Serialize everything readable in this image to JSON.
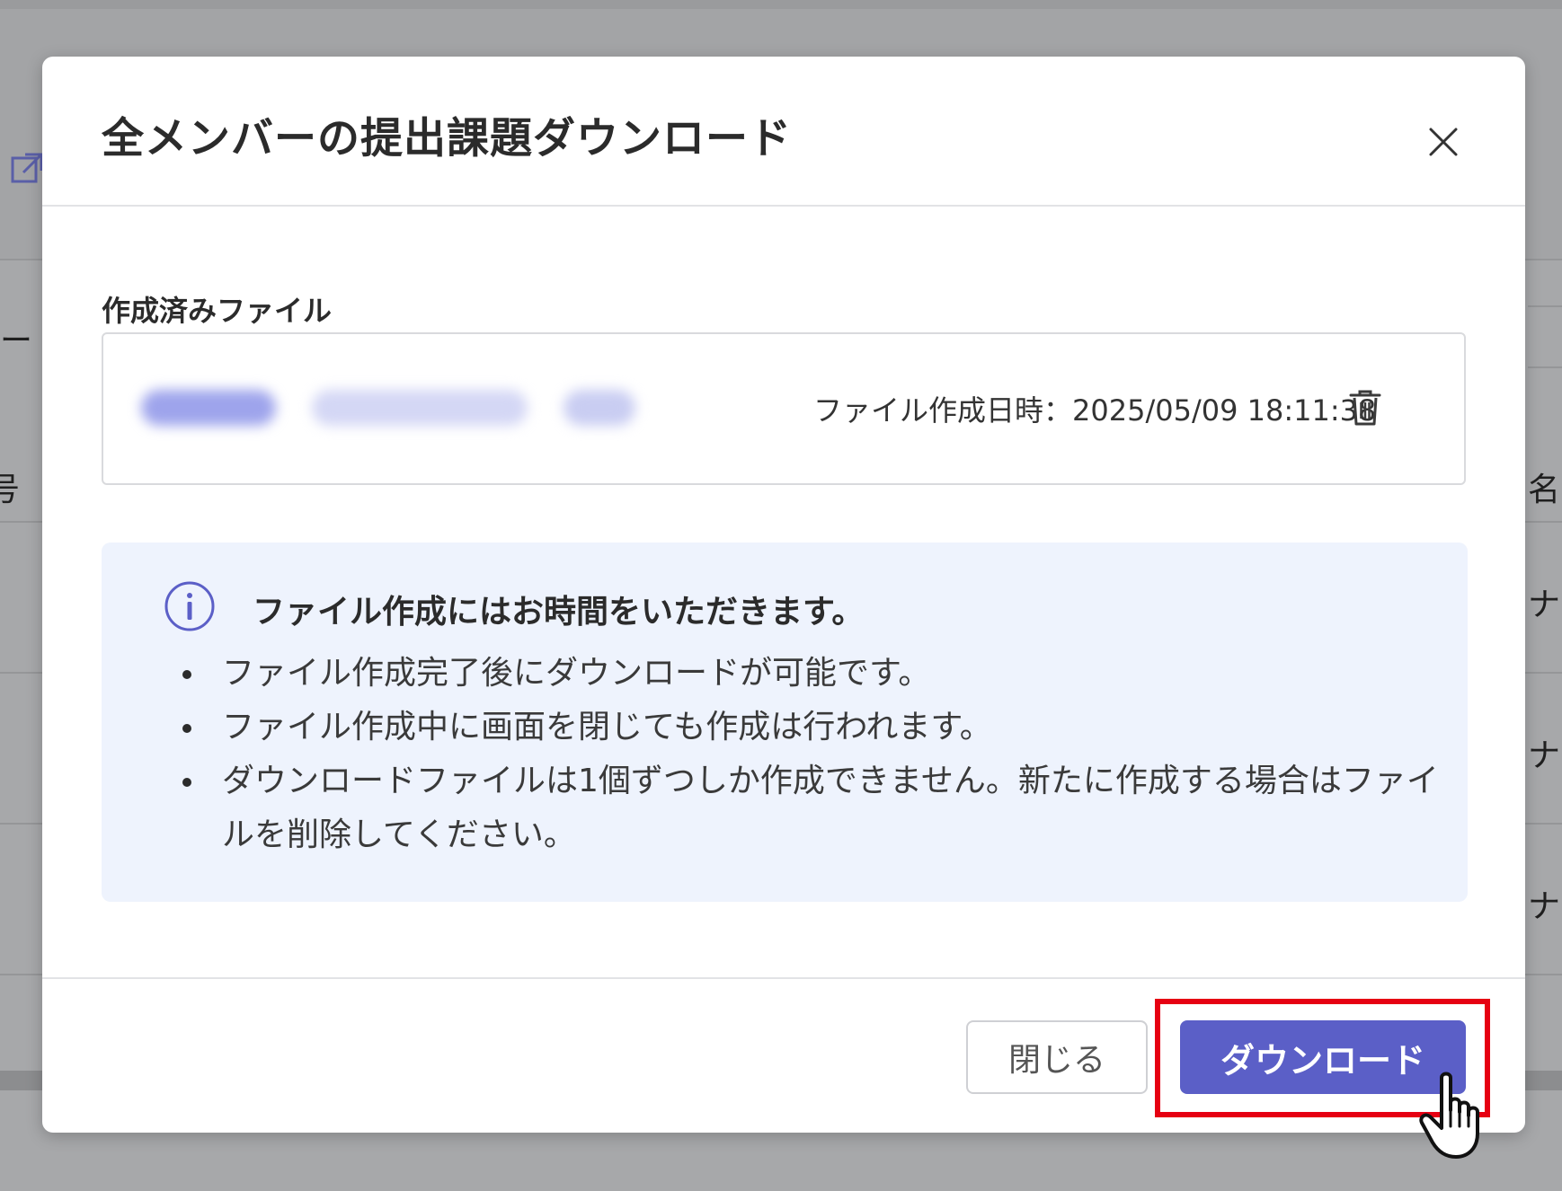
{
  "background": {
    "partial_glyphs": [
      "ー",
      "号",
      "名",
      "ナ",
      "ナ",
      "ナ"
    ]
  },
  "modal": {
    "title": "全メンバーの提出課題ダウンロード",
    "close_label": "×",
    "file_section": {
      "label": "作成済みファイル",
      "file": {
        "created_at": "ファイル作成日時：2025/05/09 18:11:38"
      }
    },
    "info": {
      "title": "ファイル作成にはお時間をいただきます。",
      "items": [
        "ファイル作成完了後にダウンロードが可能です。",
        "ファイル作成中に画面を閉じても作成は行われます。",
        "ダウンロードファイルは1個ずつしか作成できません。新たに作成する場合はファイルを削除してください。"
      ]
    },
    "footer": {
      "close_button": "閉じる",
      "download_button": "ダウンロード"
    }
  },
  "colors": {
    "primary": "#5b5fc7",
    "info_bg": "#eef3fd",
    "highlight": "#e60012",
    "overlay": "#a7a8aa"
  },
  "icons": {
    "close": "close-icon",
    "trash": "trash-icon",
    "info": "info-icon",
    "external_link": "external-link-icon",
    "cursor": "hand-pointer-icon"
  }
}
